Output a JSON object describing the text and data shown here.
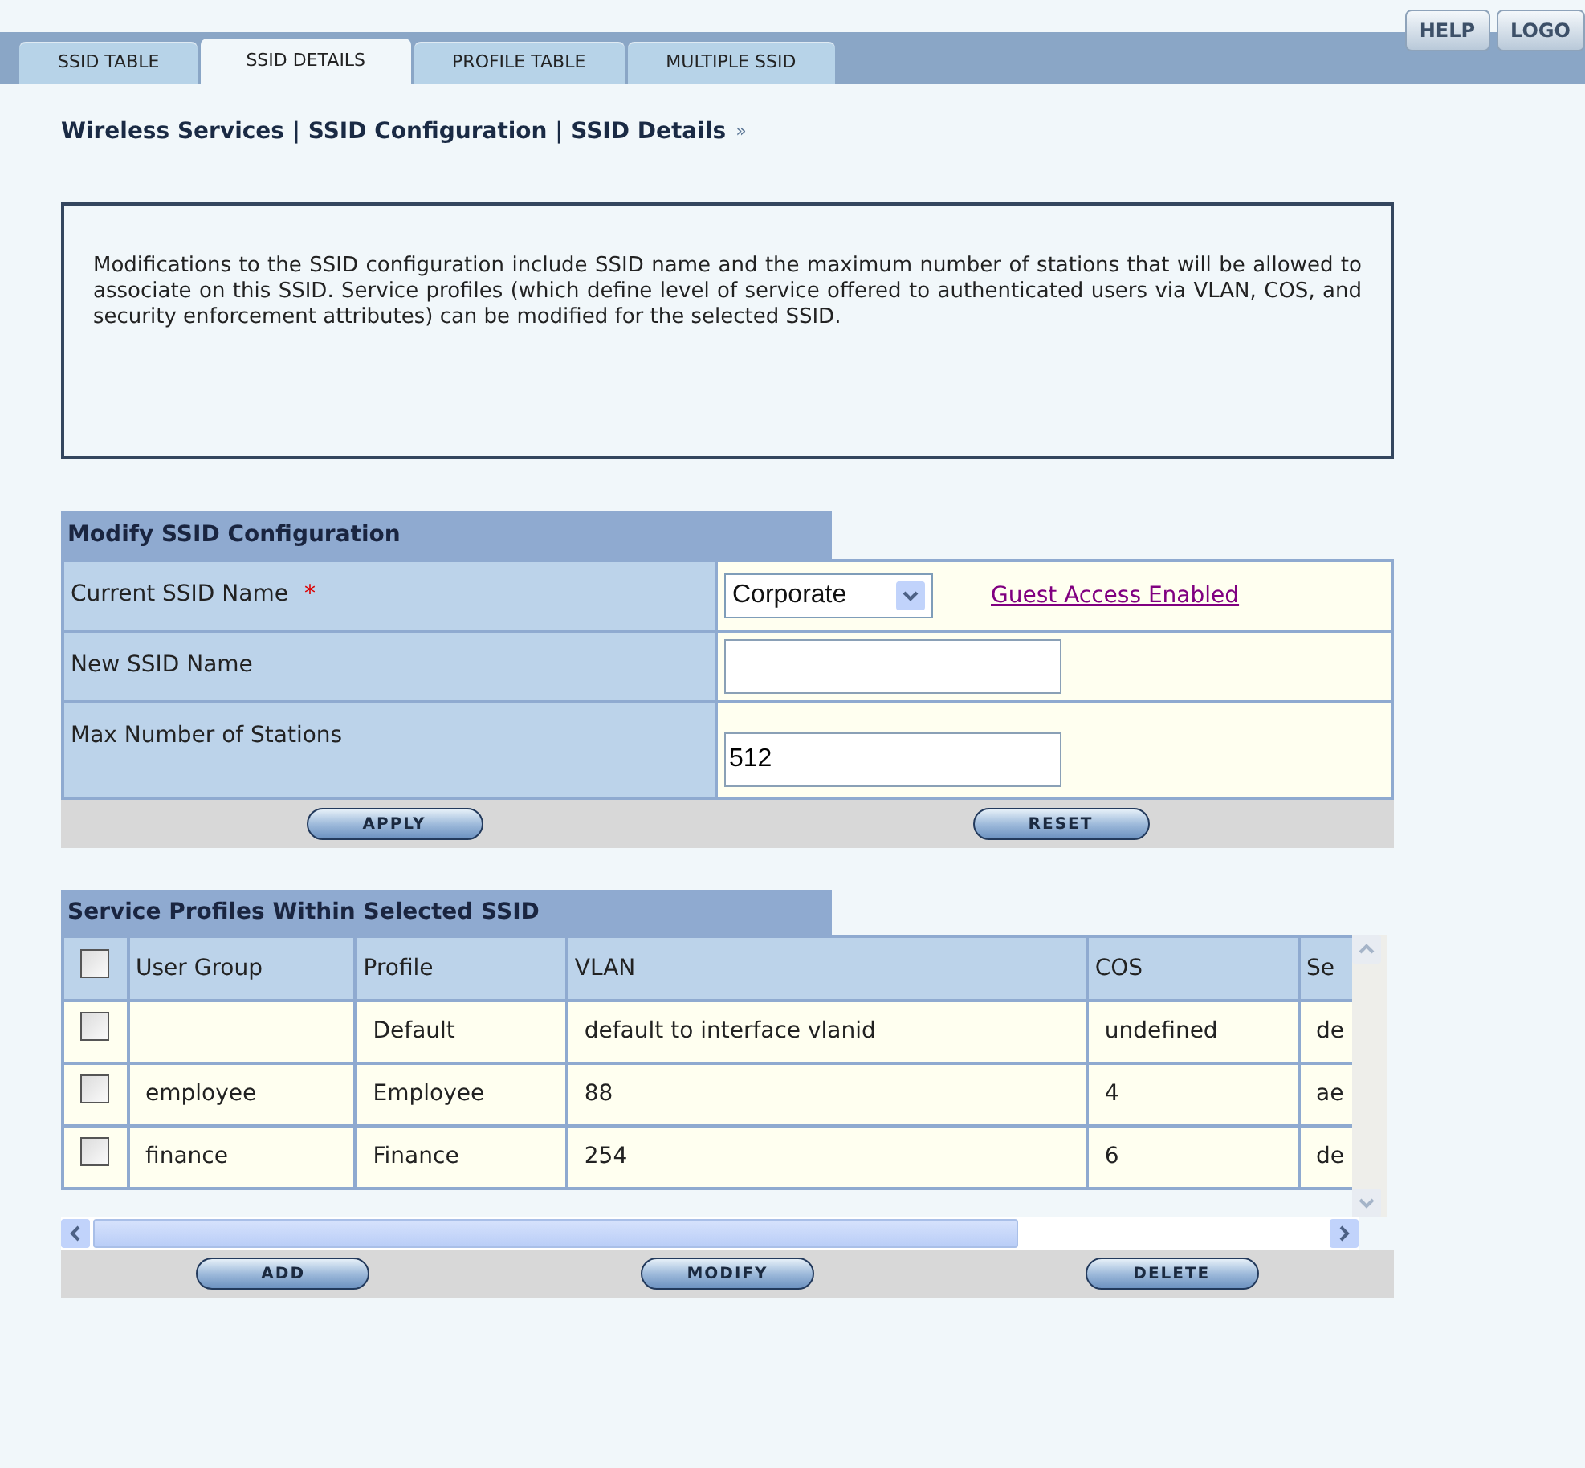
{
  "tabs": [
    {
      "label": "SSID TABLE",
      "selected": false
    },
    {
      "label": "SSID DETAILS",
      "selected": true
    },
    {
      "label": "PROFILE TABLE",
      "selected": false
    },
    {
      "label": "MULTIPLE SSID",
      "selected": false
    }
  ],
  "header_buttons": [
    "HELP",
    "LOGO"
  ],
  "breadcrumb": "Wireless Services | SSID Configuration | SSID Details",
  "breadcrumb_arrow": "»",
  "description": "Modifications to the SSID configuration include SSID name and the maximum number of stations that will be allowed to associate on this SSID. Service profiles (which define level of service offered to authenticated users via VLAN, COS, and security enforcement attributes) can be modified for the selected SSID.",
  "modify_section": {
    "title": "Modify SSID Configuration",
    "fields": [
      {
        "kind": "select",
        "label": "Current SSID Name",
        "required_mark": "*",
        "value": "Corporate",
        "link": "Guest Access Enabled"
      },
      {
        "kind": "text",
        "label": "New SSID Name"
      },
      {
        "kind": "text",
        "label": "Max Number of Stations",
        "value": "512"
      }
    ],
    "buttons": [
      "APPLY",
      "RESET"
    ]
  },
  "profiles_section": {
    "title": "Service Profiles Within Selected SSID",
    "header_checked": false,
    "columns": [
      "User Group",
      "Profile",
      "VLAN",
      "COS",
      "Se"
    ],
    "rows": [
      {
        "checked": false,
        "cells": [
          "",
          "Default",
          "default to interface vlanid",
          "undefined",
          "de"
        ]
      },
      {
        "checked": false,
        "cells": [
          "employee",
          "Employee",
          "88",
          "4",
          "ae"
        ]
      },
      {
        "checked": false,
        "cells": [
          "finance",
          "Finance",
          "254",
          "6",
          "de"
        ]
      }
    ],
    "buttons": [
      "ADD",
      "MODIFY",
      "DELETE"
    ]
  }
}
